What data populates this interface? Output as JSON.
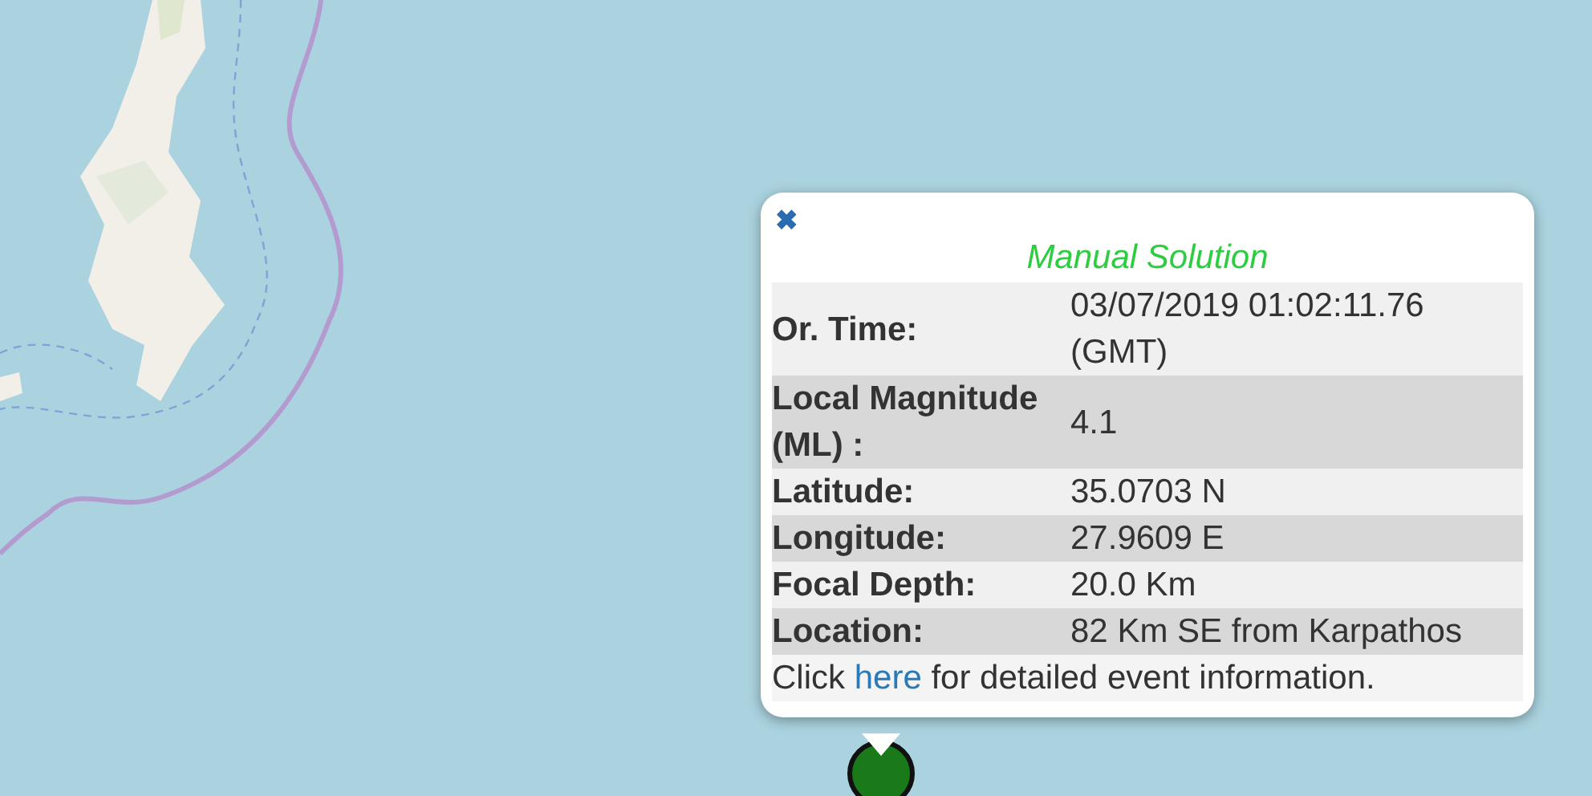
{
  "popup": {
    "close": "✖",
    "title": "Manual Solution",
    "rows": [
      {
        "label": "Or. Time:",
        "value": "03/07/2019 01:02:11.76 (GMT)"
      },
      {
        "label": "Local Magnitude (ML) :",
        "value": "4.1"
      },
      {
        "label": "Latitude:",
        "value": "35.0703 N"
      },
      {
        "label": "Longitude:",
        "value": "27.9609 E"
      },
      {
        "label": "Focal Depth:",
        "value": "20.0 Km"
      },
      {
        "label": "Location:",
        "value": "82 Km SE from Karpathos"
      }
    ],
    "footer": {
      "before": "Click",
      "link": "here",
      "after": "for detailed event information."
    }
  }
}
